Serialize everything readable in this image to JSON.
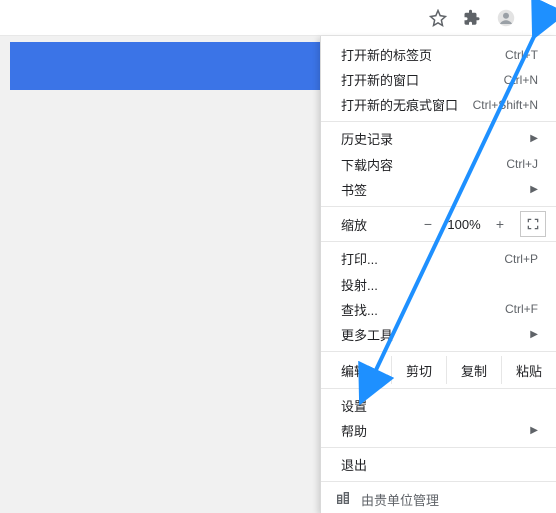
{
  "toolbar": {
    "icons": {
      "star": "star-icon",
      "extensions": "puzzle-icon",
      "profile": "profile-icon",
      "menu": "kebab-menu-icon"
    }
  },
  "menu": {
    "newTab": {
      "label": "打开新的标签页",
      "shortcut": "Ctrl+T"
    },
    "newWindow": {
      "label": "打开新的窗口",
      "shortcut": "Ctrl+N"
    },
    "incognito": {
      "label": "打开新的无痕式窗口",
      "shortcut": "Ctrl+Shift+N"
    },
    "history": {
      "label": "历史记录"
    },
    "downloads": {
      "label": "下载内容",
      "shortcut": "Ctrl+J"
    },
    "bookmarks": {
      "label": "书签"
    },
    "zoom": {
      "label": "缩放",
      "minus": "−",
      "value": "100%",
      "plus": "+"
    },
    "print": {
      "label": "打印...",
      "shortcut": "Ctrl+P"
    },
    "cast": {
      "label": "投射..."
    },
    "find": {
      "label": "查找...",
      "shortcut": "Ctrl+F"
    },
    "moreTools": {
      "label": "更多工具"
    },
    "edit": {
      "label": "编辑",
      "cut": "剪切",
      "copy": "复制",
      "paste": "粘贴"
    },
    "settings": {
      "label": "设置"
    },
    "help": {
      "label": "帮助"
    },
    "exit": {
      "label": "退出"
    },
    "managed": {
      "label": "由贵单位管理"
    }
  }
}
